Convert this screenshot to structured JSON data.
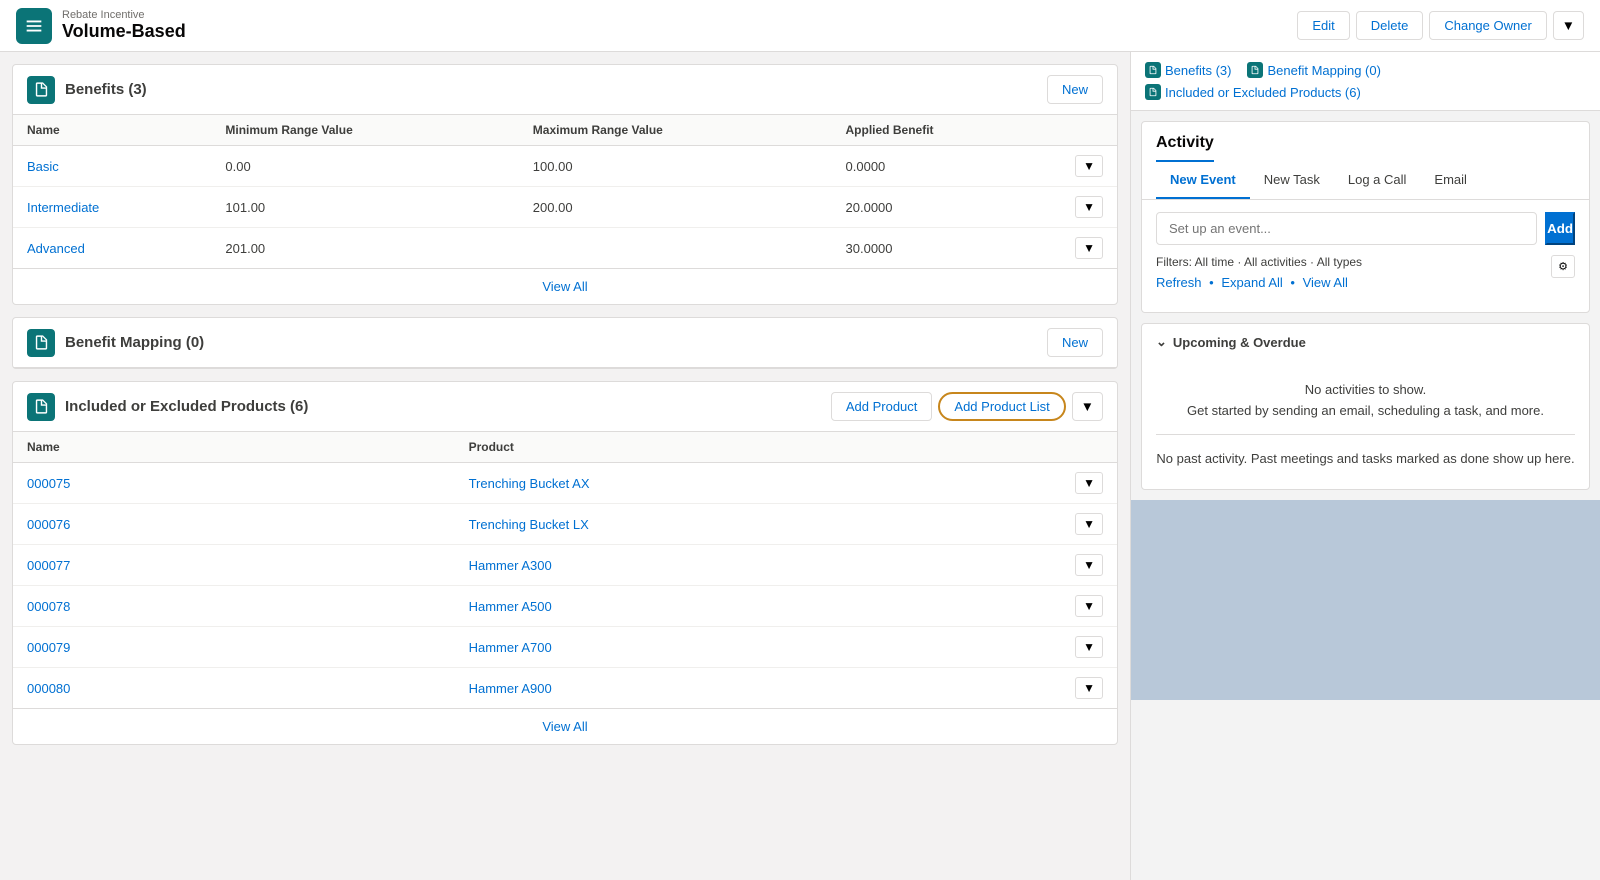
{
  "header": {
    "subtitle": "Rebate Incentive",
    "title": "Volume-Based",
    "edit_label": "Edit",
    "delete_label": "Delete",
    "change_owner_label": "Change Owner"
  },
  "sidebar_nav": {
    "links": [
      {
        "label": "Benefits (3)",
        "id": "benefits"
      },
      {
        "label": "Benefit Mapping (0)",
        "id": "benefit-mapping"
      },
      {
        "label": "Included or Excluded Products (6)",
        "id": "included-excluded"
      }
    ]
  },
  "benefits_section": {
    "title": "Benefits (3)",
    "new_label": "New",
    "columns": [
      "Name",
      "Minimum Range Value",
      "Maximum Range Value",
      "Applied Benefit"
    ],
    "rows": [
      {
        "name": "Basic",
        "min": "0.00",
        "max": "100.00",
        "benefit": "0.0000"
      },
      {
        "name": "Intermediate",
        "min": "101.00",
        "max": "200.00",
        "benefit": "20.0000"
      },
      {
        "name": "Advanced",
        "min": "201.00",
        "max": "",
        "benefit": "30.0000"
      }
    ],
    "view_all_label": "View All"
  },
  "benefit_mapping_section": {
    "title": "Benefit Mapping (0)",
    "new_label": "New"
  },
  "included_excluded_section": {
    "title": "Included or Excluded Products (6)",
    "add_product_label": "Add Product",
    "add_product_list_label": "Add Product List",
    "columns": [
      "Name",
      "Product"
    ],
    "rows": [
      {
        "name": "000075",
        "product": "Trenching Bucket AX"
      },
      {
        "name": "000076",
        "product": "Trenching Bucket LX"
      },
      {
        "name": "000077",
        "product": "Hammer A300"
      },
      {
        "name": "000078",
        "product": "Hammer A500"
      },
      {
        "name": "000079",
        "product": "Hammer A700"
      },
      {
        "name": "000080",
        "product": "Hammer A900"
      }
    ],
    "view_all_label": "View All"
  },
  "activity": {
    "title": "Activity",
    "tabs": [
      "New Event",
      "New Task",
      "Log a Call",
      "Email"
    ],
    "active_tab": "New Event",
    "event_placeholder": "Set up an event...",
    "add_label": "Add",
    "filters_label": "Filters: All time · All activities · All types",
    "links": [
      "Refresh",
      "Expand All",
      "View All"
    ]
  },
  "upcoming": {
    "title": "Upcoming & Overdue",
    "no_activities": "No activities to show.",
    "get_started": "Get started by sending an email, scheduling a task, and more.",
    "no_past": "No past activity. Past meetings and tasks marked as done show up here."
  }
}
